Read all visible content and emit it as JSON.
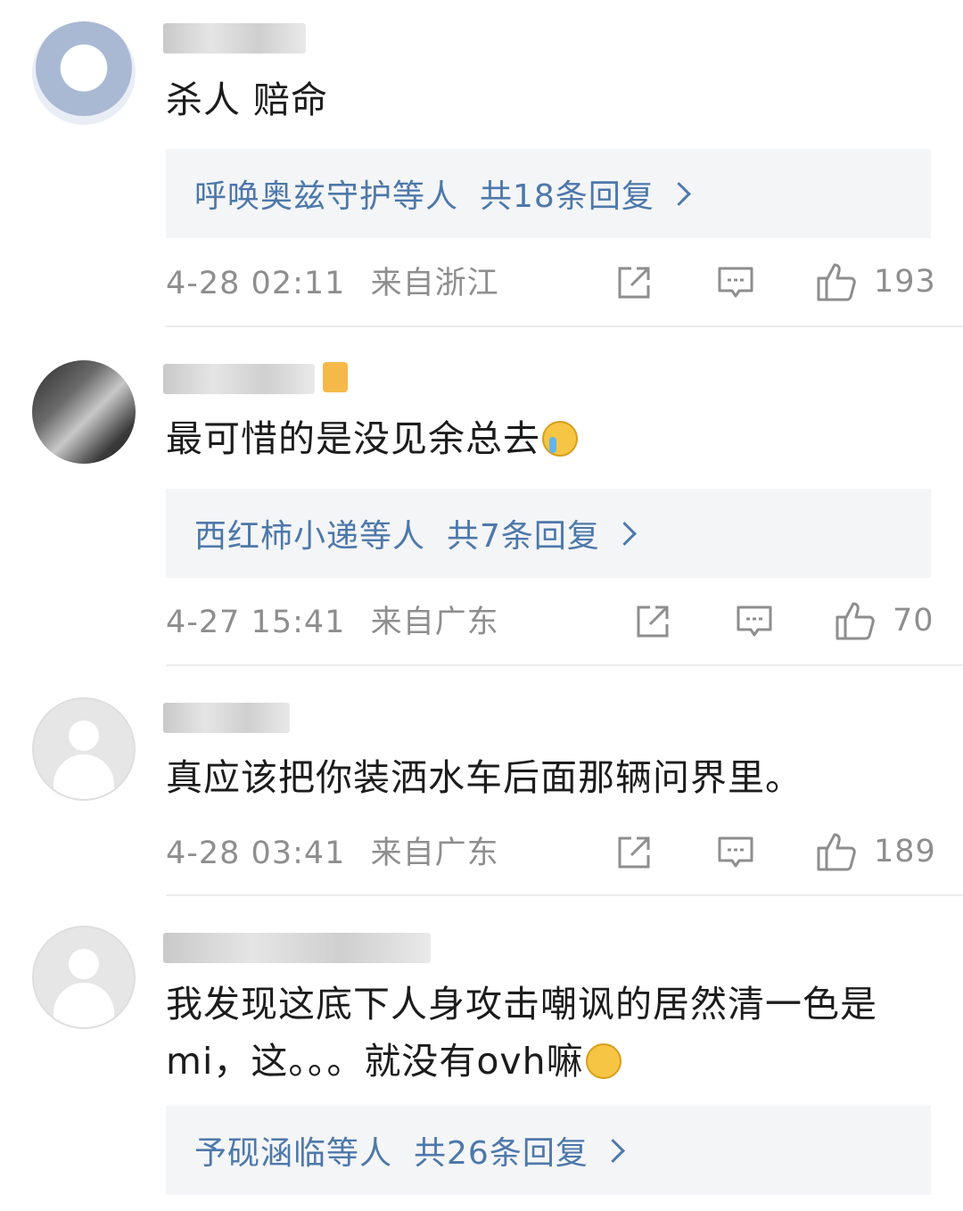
{
  "comments": [
    {
      "username": "••••••",
      "text": "杀人 赔命",
      "replies": {
        "who": "呼唤奥兹守护等人",
        "count": "共18条回复"
      },
      "time": "4-28 02:11",
      "location": "来自浙江",
      "likes": "193"
    },
    {
      "username": "••••••",
      "text": "最可惜的是没见余总去",
      "emoji": "crying-face",
      "replies": {
        "who": "西红柿小递等人",
        "count": "共7条回复"
      },
      "time": "4-27 15:41",
      "location": "来自广东",
      "likes": "70"
    },
    {
      "username": "••••••",
      "text": "真应该把你装洒水车后面那辆问界里。",
      "time": "4-28 03:41",
      "location": "来自广东",
      "likes": "189"
    },
    {
      "username": "••••••",
      "text_line1": "我发现这底下人身攻击嘲讽的居然清一色是",
      "text_line2": "mi，这。。。就没有ovh嘛",
      "emoji": "speechless-face",
      "replies": {
        "who": "予砚涵临等人",
        "count": "共26条回复"
      }
    }
  ],
  "colors": {
    "link": "#4d78aa",
    "meta": "#8e8e8e",
    "reply_bg": "#f4f5f7"
  }
}
